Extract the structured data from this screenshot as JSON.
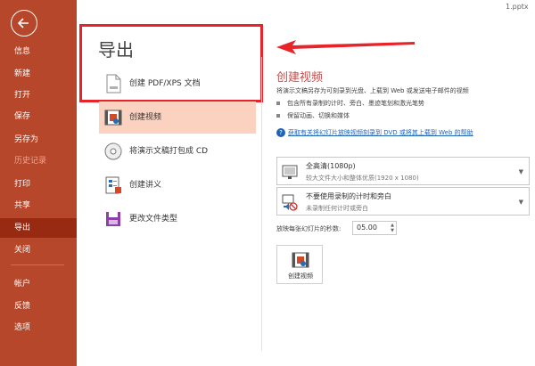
{
  "file_name": "1.pptx",
  "nav": {
    "items": [
      {
        "label": "信息"
      },
      {
        "label": "新建"
      },
      {
        "label": "打开"
      },
      {
        "label": "保存"
      },
      {
        "label": "另存为"
      },
      {
        "label": "历史记录"
      },
      {
        "label": "打印"
      },
      {
        "label": "共享"
      },
      {
        "label": "导出"
      },
      {
        "label": "关闭"
      },
      {
        "label": "帐户"
      },
      {
        "label": "反馈"
      },
      {
        "label": "选项"
      }
    ]
  },
  "export": {
    "title": "导出",
    "options": [
      {
        "label": "创建 PDF/XPS 文档"
      },
      {
        "label": "创建视频"
      },
      {
        "label": "将演示文稿打包成 CD"
      },
      {
        "label": "创建讲义"
      },
      {
        "label": "更改文件类型"
      }
    ]
  },
  "video": {
    "title": "创建视频",
    "description": "将演示文稿另存为可刻录到光盘、上载到 Web 或发送电子邮件的视频",
    "bullets": [
      "包含所有录制的计时、旁白、墨迹笔划和激光笔势",
      "保留动画、切换和媒体"
    ],
    "help_link": "获取有关将幻灯片放映视频刻录到 DVD 或将其上载到 Web 的帮助",
    "quality": {
      "main": "全高清(1080p)",
      "sub": "较大文件大小和整体优质(1920 x 1080)"
    },
    "timing": {
      "main": "不要使用录制的计时和旁白",
      "sub": "未录制任何计时或旁白"
    },
    "seconds_label": "放映每张幻灯片的秒数:",
    "seconds_value": "05.00",
    "create_button": "创建视频"
  },
  "colors": {
    "sidebar": "#b7472a",
    "active_nav": "#992a12",
    "selected_option": "#fbd1c0",
    "accent_title": "#c0504d",
    "annotation_red": "#e8232a",
    "link": "#1f63b7"
  },
  "icons": {
    "back": "back-arrow-icon",
    "pdf": "pdf-document-icon",
    "video": "video-film-icon",
    "cd": "cd-disc-icon",
    "handout": "handout-icon",
    "filetype": "file-type-icon"
  }
}
